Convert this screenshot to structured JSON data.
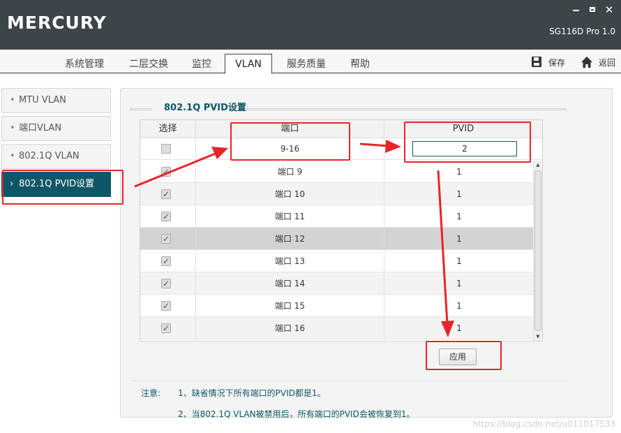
{
  "app": {
    "logo": "MERCURY",
    "model": "SG116D Pro 1.0"
  },
  "nav": {
    "tabs": [
      {
        "label": "系统管理"
      },
      {
        "label": "二层交换"
      },
      {
        "label": "监控"
      },
      {
        "label": "VLAN",
        "active": true
      },
      {
        "label": "服务质量"
      },
      {
        "label": "帮助"
      }
    ],
    "save_label": "保存",
    "back_label": "返回"
  },
  "sidebar": {
    "items": [
      {
        "label": "MTU VLAN"
      },
      {
        "label": "端口VLAN"
      },
      {
        "label": "802.1Q VLAN"
      },
      {
        "label": "802.1Q PVID设置",
        "active": true
      }
    ]
  },
  "section": {
    "title": "802.1Q PVID设置"
  },
  "table": {
    "headers": [
      "选择",
      "端口",
      "PVID"
    ],
    "edit_row": {
      "port": "9-16",
      "pvid": "2"
    },
    "rows": [
      {
        "port": "端口 9",
        "pvid": "1"
      },
      {
        "port": "端口 10",
        "pvid": "1"
      },
      {
        "port": "端口 11",
        "pvid": "1"
      },
      {
        "port": "端口 12",
        "pvid": "1"
      },
      {
        "port": "端口 13",
        "pvid": "1"
      },
      {
        "port": "端口 14",
        "pvid": "1"
      },
      {
        "port": "端口 15",
        "pvid": "1"
      },
      {
        "port": "端口 16",
        "pvid": "1"
      }
    ]
  },
  "apply_label": "应用",
  "notes": {
    "label": "注意:",
    "items": [
      "1、缺省情况下所有端口的PVID都是1。",
      "2、当802.1Q VLAN被禁用后，所有端口的PVID会被恢复到1。"
    ]
  },
  "watermark": "https://blog.csdn.net/u011017533",
  "colors": {
    "titlebar": "#3d4548",
    "accent": "#0e5766",
    "annotation": "#e8232a"
  }
}
